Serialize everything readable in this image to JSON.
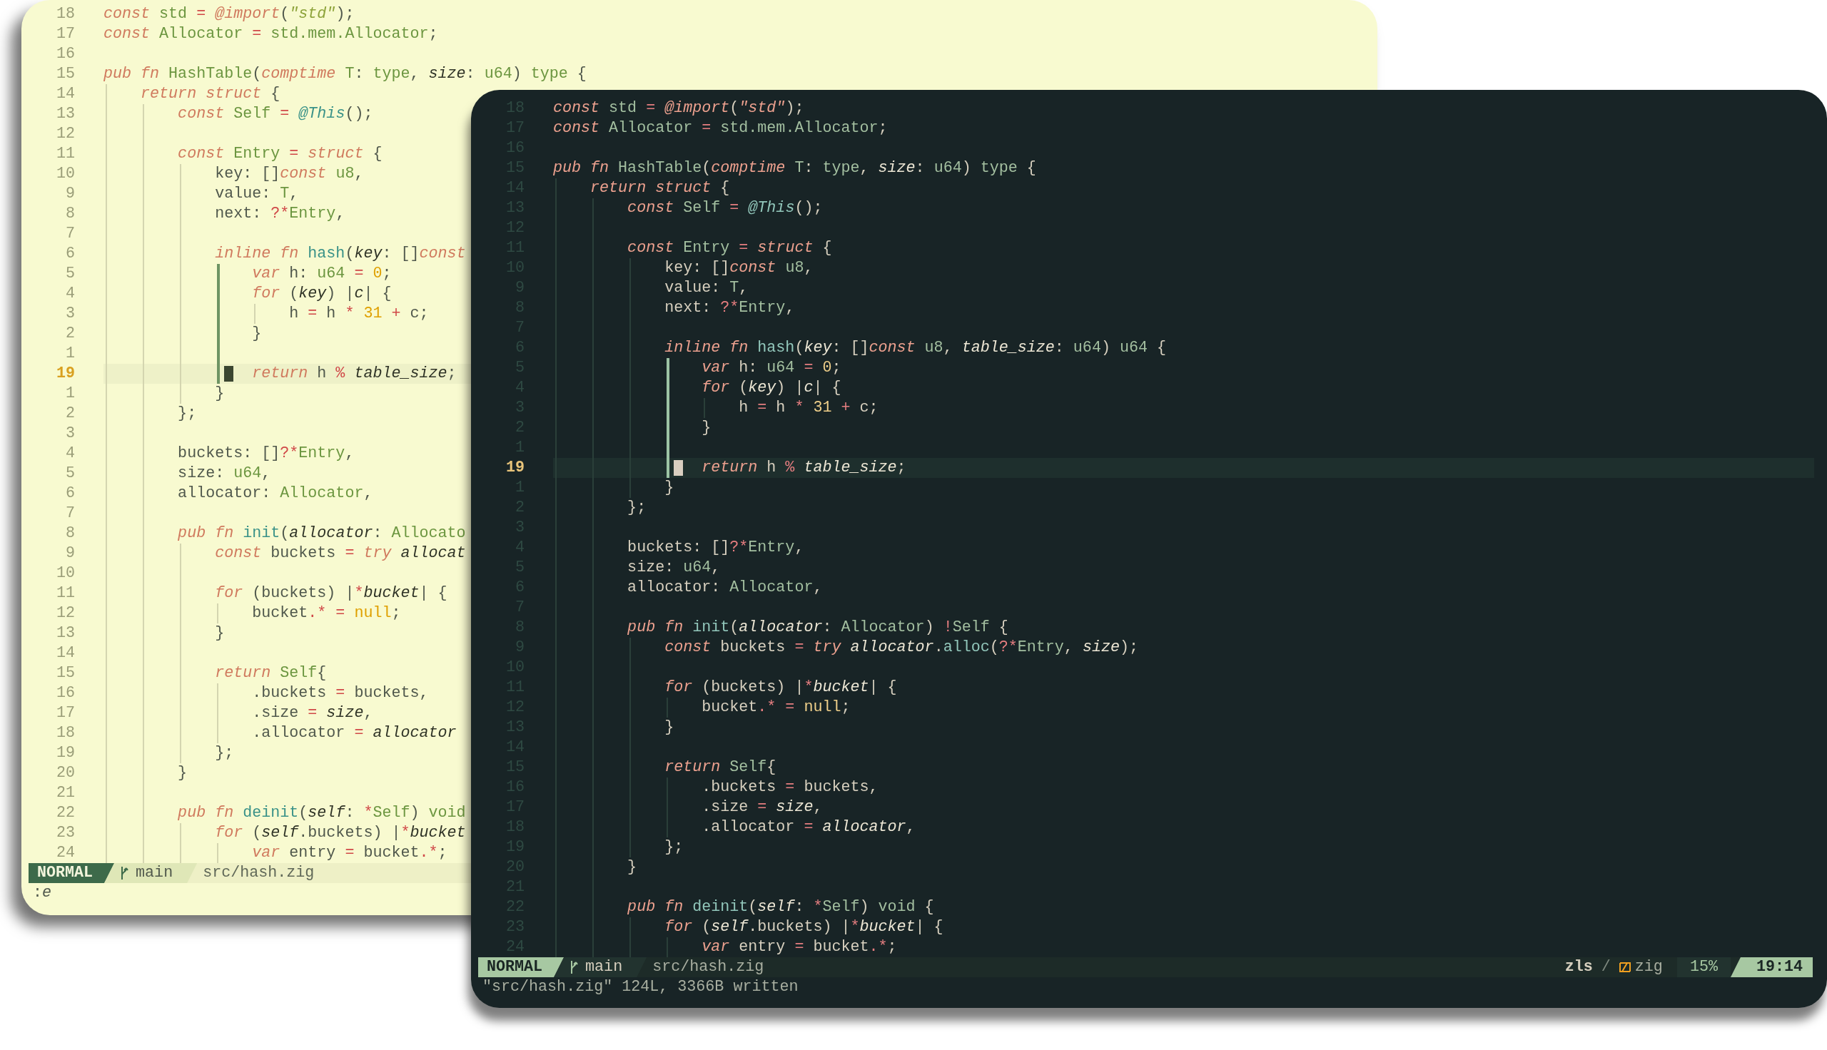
{
  "windows": [
    {
      "kind": "light",
      "lines": [
        {
          "number": "18",
          "current": false,
          "code": [
            {
              "kind": "kw",
              "text": "const "
            },
            {
              "kind": "type",
              "text": "std"
            },
            {
              "kind": "op",
              "text": " = "
            },
            {
              "kind": "kw",
              "text": "@import"
            },
            {
              "kind": "plain",
              "text": "("
            },
            {
              "kind": "str",
              "text": "\"std\""
            },
            {
              "kind": "plain",
              "text": ");"
            }
          ]
        },
        {
          "number": "17",
          "current": false,
          "code": [
            {
              "kind": "kw",
              "text": "const "
            },
            {
              "kind": "type",
              "text": "Allocator"
            },
            {
              "kind": "op",
              "text": " = "
            },
            {
              "kind": "type",
              "text": "std.mem.Allocator"
            },
            {
              "kind": "plain",
              "text": ";"
            }
          ]
        },
        {
          "number": "16",
          "current": false
        },
        {
          "number": "15",
          "current": false,
          "code": [
            {
              "kind": "kw",
              "text": "pub fn "
            },
            {
              "kind": "type",
              "text": "HashTable"
            },
            {
              "kind": "plain",
              "text": "("
            },
            {
              "kind": "kw",
              "text": "comptime "
            },
            {
              "kind": "type",
              "text": "T"
            },
            {
              "kind": "plain",
              "text": ": "
            },
            {
              "kind": "type",
              "text": "type"
            },
            {
              "kind": "plain",
              "text": ", "
            },
            {
              "kind": "param",
              "text": "size"
            },
            {
              "kind": "plain",
              "text": ": "
            },
            {
              "kind": "type",
              "text": "u64"
            },
            {
              "kind": "plain",
              "text": ") "
            },
            {
              "kind": "type",
              "text": "type"
            },
            {
              "kind": "plain",
              "text": " {"
            }
          ]
        },
        {
          "number": "14",
          "current": false,
          "code": [
            {
              "kind": "kw",
              "text": "    return struct "
            },
            {
              "kind": "plain",
              "text": "{"
            }
          ]
        },
        {
          "number": "13",
          "current": false,
          "code": [
            {
              "kind": "kw",
              "text": "        const "
            },
            {
              "kind": "type",
              "text": "Self"
            },
            {
              "kind": "op",
              "text": " = "
            },
            {
              "kind": "builtin",
              "text": "@This"
            },
            {
              "kind": "plain",
              "text": "();"
            }
          ]
        },
        {
          "number": "12",
          "current": false
        },
        {
          "number": "11",
          "current": false,
          "code": [
            {
              "kind": "kw",
              "text": "        const "
            },
            {
              "kind": "type",
              "text": "Entry"
            },
            {
              "kind": "op",
              "text": " = "
            },
            {
              "kind": "kw",
              "text": "struct "
            },
            {
              "kind": "plain",
              "text": "{"
            }
          ]
        },
        {
          "number": "10",
          "current": false,
          "code": [
            {
              "kind": "plain",
              "text": "            key: []"
            },
            {
              "kind": "kw",
              "text": "const "
            },
            {
              "kind": "type",
              "text": "u8"
            },
            {
              "kind": "plain",
              "text": ","
            }
          ]
        },
        {
          "number": "9",
          "current": false,
          "code": [
            {
              "kind": "plain",
              "text": "            value: "
            },
            {
              "kind": "type",
              "text": "T"
            },
            {
              "kind": "plain",
              "text": ","
            }
          ]
        },
        {
          "number": "8",
          "current": false,
          "code": [
            {
              "kind": "plain",
              "text": "            next: "
            },
            {
              "kind": "op",
              "text": "?*"
            },
            {
              "kind": "type",
              "text": "Entry"
            },
            {
              "kind": "plain",
              "text": ","
            }
          ]
        },
        {
          "number": "7",
          "current": false
        },
        {
          "number": "6",
          "current": false,
          "code": [
            {
              "kind": "kw",
              "text": "            inline fn "
            },
            {
              "kind": "fn",
              "text": "hash"
            },
            {
              "kind": "plain",
              "text": "("
            },
            {
              "kind": "param",
              "text": "key"
            },
            {
              "kind": "plain",
              "text": ": []"
            },
            {
              "kind": "kw",
              "text": "const"
            }
          ]
        },
        {
          "number": "5",
          "current": false,
          "code": [
            {
              "kind": "kw",
              "text": "                var "
            },
            {
              "kind": "plain",
              "text": "h: "
            },
            {
              "kind": "type",
              "text": "u64"
            },
            {
              "kind": "op",
              "text": " = "
            },
            {
              "kind": "num",
              "text": "0"
            },
            {
              "kind": "plain",
              "text": ";"
            }
          ]
        },
        {
          "number": "4",
          "current": false,
          "code": [
            {
              "kind": "kw",
              "text": "                for "
            },
            {
              "kind": "plain",
              "text": "("
            },
            {
              "kind": "param",
              "text": "key"
            },
            {
              "kind": "plain",
              "text": ") |"
            },
            {
              "kind": "param",
              "text": "c"
            },
            {
              "kind": "plain",
              "text": "| {"
            }
          ]
        },
        {
          "number": "3",
          "current": false,
          "code": [
            {
              "kind": "plain",
              "text": "                    h"
            },
            {
              "kind": "op",
              "text": " = "
            },
            {
              "kind": "plain",
              "text": "h"
            },
            {
              "kind": "op",
              "text": " * "
            },
            {
              "kind": "num",
              "text": "31"
            },
            {
              "kind": "op",
              "text": " + "
            },
            {
              "kind": "plain",
              "text": "c;"
            }
          ]
        },
        {
          "number": "2",
          "current": false,
          "code": [
            {
              "kind": "plain",
              "text": "                }"
            }
          ]
        },
        {
          "number": "1",
          "current": false
        },
        {
          "number": "19",
          "current": true,
          "code": [
            {
              "kind": "kw",
              "text": "                return "
            },
            {
              "kind": "plain",
              "text": "h"
            },
            {
              "kind": "op",
              "text": " % "
            },
            {
              "kind": "param",
              "text": "table_size"
            },
            {
              "kind": "plain",
              "text": ";"
            }
          ]
        },
        {
          "number": "1",
          "current": false,
          "code": [
            {
              "kind": "plain",
              "text": "            }"
            }
          ]
        },
        {
          "number": "2",
          "current": false,
          "code": [
            {
              "kind": "plain",
              "text": "        };"
            }
          ]
        },
        {
          "number": "3",
          "current": false
        },
        {
          "number": "4",
          "current": false,
          "code": [
            {
              "kind": "plain",
              "text": "        buckets: []"
            },
            {
              "kind": "op",
              "text": "?*"
            },
            {
              "kind": "type",
              "text": "Entry"
            },
            {
              "kind": "plain",
              "text": ","
            }
          ]
        },
        {
          "number": "5",
          "current": false,
          "code": [
            {
              "kind": "plain",
              "text": "        size: "
            },
            {
              "kind": "type",
              "text": "u64"
            },
            {
              "kind": "plain",
              "text": ","
            }
          ]
        },
        {
          "number": "6",
          "current": false,
          "code": [
            {
              "kind": "plain",
              "text": "        allocator: "
            },
            {
              "kind": "type",
              "text": "Allocator"
            },
            {
              "kind": "plain",
              "text": ","
            }
          ]
        },
        {
          "number": "7",
          "current": false
        },
        {
          "number": "8",
          "current": false,
          "code": [
            {
              "kind": "kw",
              "text": "        pub fn "
            },
            {
              "kind": "fn",
              "text": "init"
            },
            {
              "kind": "plain",
              "text": "("
            },
            {
              "kind": "param",
              "text": "allocator"
            },
            {
              "kind": "plain",
              "text": ": "
            },
            {
              "kind": "type",
              "text": "Allocato"
            }
          ]
        },
        {
          "number": "9",
          "current": false,
          "code": [
            {
              "kind": "kw",
              "text": "            const "
            },
            {
              "kind": "plain",
              "text": "buckets"
            },
            {
              "kind": "op",
              "text": " = "
            },
            {
              "kind": "kw",
              "text": "try "
            },
            {
              "kind": "param",
              "text": "allocat"
            }
          ]
        },
        {
          "number": "10",
          "current": false
        },
        {
          "number": "11",
          "current": false,
          "code": [
            {
              "kind": "kw",
              "text": "            for "
            },
            {
              "kind": "plain",
              "text": "(buckets) |"
            },
            {
              "kind": "op",
              "text": "*"
            },
            {
              "kind": "param",
              "text": "bucket"
            },
            {
              "kind": "plain",
              "text": "| {"
            }
          ]
        },
        {
          "number": "12",
          "current": false,
          "code": [
            {
              "kind": "plain",
              "text": "                bucket"
            },
            {
              "kind": "op",
              "text": ".* = "
            },
            {
              "kind": "num",
              "text": "null"
            },
            {
              "kind": "plain",
              "text": ";"
            }
          ]
        },
        {
          "number": "13",
          "current": false,
          "code": [
            {
              "kind": "plain",
              "text": "            }"
            }
          ]
        },
        {
          "number": "14",
          "current": false
        },
        {
          "number": "15",
          "current": false,
          "code": [
            {
              "kind": "kw",
              "text": "            return "
            },
            {
              "kind": "type",
              "text": "Self"
            },
            {
              "kind": "plain",
              "text": "{"
            }
          ]
        },
        {
          "number": "16",
          "current": false,
          "code": [
            {
              "kind": "plain",
              "text": "                .buckets"
            },
            {
              "kind": "op",
              "text": " = "
            },
            {
              "kind": "plain",
              "text": "buckets,"
            }
          ]
        },
        {
          "number": "17",
          "current": false,
          "code": [
            {
              "kind": "plain",
              "text": "                .size"
            },
            {
              "kind": "op",
              "text": " = "
            },
            {
              "kind": "param",
              "text": "size"
            },
            {
              "kind": "plain",
              "text": ","
            }
          ]
        },
        {
          "number": "18",
          "current": false,
          "code": [
            {
              "kind": "plain",
              "text": "                .allocator"
            },
            {
              "kind": "op",
              "text": " = "
            },
            {
              "kind": "param",
              "text": "allocator"
            }
          ]
        },
        {
          "number": "19",
          "current": false,
          "code": [
            {
              "kind": "plain",
              "text": "            };"
            }
          ]
        },
        {
          "number": "20",
          "current": false,
          "code": [
            {
              "kind": "plain",
              "text": "        }"
            }
          ]
        },
        {
          "number": "21",
          "current": false
        },
        {
          "number": "22",
          "current": false,
          "code": [
            {
              "kind": "kw",
              "text": "        pub fn "
            },
            {
              "kind": "fn",
              "text": "deinit"
            },
            {
              "kind": "plain",
              "text": "("
            },
            {
              "kind": "param",
              "text": "self"
            },
            {
              "kind": "plain",
              "text": ": "
            },
            {
              "kind": "op",
              "text": "*"
            },
            {
              "kind": "type",
              "text": "Self"
            },
            {
              "kind": "plain",
              "text": ") "
            },
            {
              "kind": "type",
              "text": "void"
            }
          ]
        },
        {
          "number": "23",
          "current": false,
          "code": [
            {
              "kind": "kw",
              "text": "            for "
            },
            {
              "kind": "plain",
              "text": "("
            },
            {
              "kind": "param",
              "text": "self"
            },
            {
              "kind": "plain",
              "text": ".buckets) |"
            },
            {
              "kind": "op",
              "text": "*"
            },
            {
              "kind": "param",
              "text": "bucket"
            }
          ]
        },
        {
          "number": "24",
          "current": false,
          "code": [
            {
              "kind": "kw",
              "text": "                var "
            },
            {
              "kind": "plain",
              "text": "entry"
            },
            {
              "kind": "op",
              "text": " = "
            },
            {
              "kind": "plain",
              "text": "bucket"
            },
            {
              "kind": "op",
              "text": ".*"
            },
            {
              "kind": "plain",
              "text": ";"
            }
          ]
        }
      ],
      "status": {
        "mode": "NORMAL",
        "branch": "main",
        "file": "src/hash.zig"
      },
      "command_line": ":*e*"
    },
    {
      "kind": "dark",
      "lines": [
        {
          "number": "18",
          "current": false,
          "code": [
            {
              "kind": "kw",
              "text": "const "
            },
            {
              "kind": "type",
              "text": "std"
            },
            {
              "kind": "op",
              "text": " = "
            },
            {
              "kind": "kw",
              "text": "@import"
            },
            {
              "kind": "plain",
              "text": "("
            },
            {
              "kind": "str",
              "text": "\"std\""
            },
            {
              "kind": "plain",
              "text": ");"
            }
          ]
        },
        {
          "number": "17",
          "current": false,
          "code": [
            {
              "kind": "kw",
              "text": "const "
            },
            {
              "kind": "type",
              "text": "Allocator"
            },
            {
              "kind": "op",
              "text": " = "
            },
            {
              "kind": "type",
              "text": "std.mem.Allocator"
            },
            {
              "kind": "plain",
              "text": ";"
            }
          ]
        },
        {
          "number": "16",
          "current": false
        },
        {
          "number": "15",
          "current": false,
          "code": [
            {
              "kind": "kw",
              "text": "pub fn "
            },
            {
              "kind": "type",
              "text": "HashTable"
            },
            {
              "kind": "plain",
              "text": "("
            },
            {
              "kind": "kw",
              "text": "comptime "
            },
            {
              "kind": "type",
              "text": "T"
            },
            {
              "kind": "plain",
              "text": ": "
            },
            {
              "kind": "type",
              "text": "type"
            },
            {
              "kind": "plain",
              "text": ", "
            },
            {
              "kind": "param",
              "text": "size"
            },
            {
              "kind": "plain",
              "text": ": "
            },
            {
              "kind": "type",
              "text": "u64"
            },
            {
              "kind": "plain",
              "text": ") "
            },
            {
              "kind": "type",
              "text": "type"
            },
            {
              "kind": "plain",
              "text": " {"
            }
          ]
        },
        {
          "number": "14",
          "current": false,
          "code": [
            {
              "kind": "kw",
              "text": "    return struct "
            },
            {
              "kind": "plain",
              "text": "{"
            }
          ]
        },
        {
          "number": "13",
          "current": false,
          "code": [
            {
              "kind": "kw",
              "text": "        const "
            },
            {
              "kind": "type",
              "text": "Self"
            },
            {
              "kind": "op",
              "text": " = "
            },
            {
              "kind": "builtin",
              "text": "@This"
            },
            {
              "kind": "plain",
              "text": "();"
            }
          ]
        },
        {
          "number": "12",
          "current": false
        },
        {
          "number": "11",
          "current": false,
          "code": [
            {
              "kind": "kw",
              "text": "        const "
            },
            {
              "kind": "type",
              "text": "Entry"
            },
            {
              "kind": "op",
              "text": " = "
            },
            {
              "kind": "kw",
              "text": "struct "
            },
            {
              "kind": "plain",
              "text": "{"
            }
          ]
        },
        {
          "number": "10",
          "current": false,
          "code": [
            {
              "kind": "plain",
              "text": "            key: []"
            },
            {
              "kind": "kw",
              "text": "const "
            },
            {
              "kind": "type",
              "text": "u8"
            },
            {
              "kind": "plain",
              "text": ","
            }
          ]
        },
        {
          "number": "9",
          "current": false,
          "code": [
            {
              "kind": "plain",
              "text": "            value: "
            },
            {
              "kind": "type",
              "text": "T"
            },
            {
              "kind": "plain",
              "text": ","
            }
          ]
        },
        {
          "number": "8",
          "current": false,
          "code": [
            {
              "kind": "plain",
              "text": "            next: "
            },
            {
              "kind": "op",
              "text": "?*"
            },
            {
              "kind": "type",
              "text": "Entry"
            },
            {
              "kind": "plain",
              "text": ","
            }
          ]
        },
        {
          "number": "7",
          "current": false
        },
        {
          "number": "6",
          "current": false,
          "code": [
            {
              "kind": "kw",
              "text": "            inline fn "
            },
            {
              "kind": "fn",
              "text": "hash"
            },
            {
              "kind": "plain",
              "text": "("
            },
            {
              "kind": "param",
              "text": "key"
            },
            {
              "kind": "plain",
              "text": ": []"
            },
            {
              "kind": "kw",
              "text": "const "
            },
            {
              "kind": "type",
              "text": "u8"
            },
            {
              "kind": "plain",
              "text": ", "
            },
            {
              "kind": "param",
              "text": "table_size"
            },
            {
              "kind": "plain",
              "text": ": "
            },
            {
              "kind": "type",
              "text": "u64"
            },
            {
              "kind": "plain",
              "text": ") "
            },
            {
              "kind": "type",
              "text": "u64"
            },
            {
              "kind": "plain",
              "text": " {"
            }
          ]
        },
        {
          "number": "5",
          "current": false,
          "code": [
            {
              "kind": "kw",
              "text": "                var "
            },
            {
              "kind": "plain",
              "text": "h: "
            },
            {
              "kind": "type",
              "text": "u64"
            },
            {
              "kind": "op",
              "text": " = "
            },
            {
              "kind": "num",
              "text": "0"
            },
            {
              "kind": "plain",
              "text": ";"
            }
          ]
        },
        {
          "number": "4",
          "current": false,
          "code": [
            {
              "kind": "kw",
              "text": "                for "
            },
            {
              "kind": "plain",
              "text": "("
            },
            {
              "kind": "param",
              "text": "key"
            },
            {
              "kind": "plain",
              "text": ") |"
            },
            {
              "kind": "param",
              "text": "c"
            },
            {
              "kind": "plain",
              "text": "| {"
            }
          ]
        },
        {
          "number": "3",
          "current": false,
          "code": [
            {
              "kind": "plain",
              "text": "                    h"
            },
            {
              "kind": "op",
              "text": " = "
            },
            {
              "kind": "plain",
              "text": "h"
            },
            {
              "kind": "op",
              "text": " * "
            },
            {
              "kind": "num",
              "text": "31"
            },
            {
              "kind": "op",
              "text": " + "
            },
            {
              "kind": "plain",
              "text": "c;"
            }
          ]
        },
        {
          "number": "2",
          "current": false,
          "code": [
            {
              "kind": "plain",
              "text": "                }"
            }
          ]
        },
        {
          "number": "1",
          "current": false
        },
        {
          "number": "19",
          "current": true,
          "code": [
            {
              "kind": "kw",
              "text": "                return "
            },
            {
              "kind": "plain",
              "text": "h"
            },
            {
              "kind": "op",
              "text": " % "
            },
            {
              "kind": "param",
              "text": "table_size"
            },
            {
              "kind": "plain",
              "text": ";"
            }
          ]
        },
        {
          "number": "1",
          "current": false,
          "code": [
            {
              "kind": "plain",
              "text": "            }"
            }
          ]
        },
        {
          "number": "2",
          "current": false,
          "code": [
            {
              "kind": "plain",
              "text": "        };"
            }
          ]
        },
        {
          "number": "3",
          "current": false
        },
        {
          "number": "4",
          "current": false,
          "code": [
            {
              "kind": "plain",
              "text": "        buckets: []"
            },
            {
              "kind": "op",
              "text": "?*"
            },
            {
              "kind": "type",
              "text": "Entry"
            },
            {
              "kind": "plain",
              "text": ","
            }
          ]
        },
        {
          "number": "5",
          "current": false,
          "code": [
            {
              "kind": "plain",
              "text": "        size: "
            },
            {
              "kind": "type",
              "text": "u64"
            },
            {
              "kind": "plain",
              "text": ","
            }
          ]
        },
        {
          "number": "6",
          "current": false,
          "code": [
            {
              "kind": "plain",
              "text": "        allocator: "
            },
            {
              "kind": "type",
              "text": "Allocator"
            },
            {
              "kind": "plain",
              "text": ","
            }
          ]
        },
        {
          "number": "7",
          "current": false
        },
        {
          "number": "8",
          "current": false,
          "code": [
            {
              "kind": "kw",
              "text": "        pub fn "
            },
            {
              "kind": "fn",
              "text": "init"
            },
            {
              "kind": "plain",
              "text": "("
            },
            {
              "kind": "param",
              "text": "allocator"
            },
            {
              "kind": "plain",
              "text": ": "
            },
            {
              "kind": "type",
              "text": "Allocator"
            },
            {
              "kind": "plain",
              "text": ") "
            },
            {
              "kind": "op",
              "text": "!"
            },
            {
              "kind": "type",
              "text": "Self"
            },
            {
              "kind": "plain",
              "text": " {"
            }
          ]
        },
        {
          "number": "9",
          "current": false,
          "code": [
            {
              "kind": "kw",
              "text": "            const "
            },
            {
              "kind": "plain",
              "text": "buckets"
            },
            {
              "kind": "op",
              "text": " = "
            },
            {
              "kind": "kw",
              "text": "try "
            },
            {
              "kind": "param",
              "text": "allocator"
            },
            {
              "kind": "plain",
              "text": "."
            },
            {
              "kind": "fn",
              "text": "alloc"
            },
            {
              "kind": "plain",
              "text": "("
            },
            {
              "kind": "op",
              "text": "?*"
            },
            {
              "kind": "type",
              "text": "Entry"
            },
            {
              "kind": "plain",
              "text": ", "
            },
            {
              "kind": "param",
              "text": "size"
            },
            {
              "kind": "plain",
              "text": ");"
            }
          ]
        },
        {
          "number": "10",
          "current": false
        },
        {
          "number": "11",
          "current": false,
          "code": [
            {
              "kind": "kw",
              "text": "            for "
            },
            {
              "kind": "plain",
              "text": "(buckets) |"
            },
            {
              "kind": "op",
              "text": "*"
            },
            {
              "kind": "param",
              "text": "bucket"
            },
            {
              "kind": "plain",
              "text": "| {"
            }
          ]
        },
        {
          "number": "12",
          "current": false,
          "code": [
            {
              "kind": "plain",
              "text": "                bucket"
            },
            {
              "kind": "op",
              "text": ".* = "
            },
            {
              "kind": "num",
              "text": "null"
            },
            {
              "kind": "plain",
              "text": ";"
            }
          ]
        },
        {
          "number": "13",
          "current": false,
          "code": [
            {
              "kind": "plain",
              "text": "            }"
            }
          ]
        },
        {
          "number": "14",
          "current": false
        },
        {
          "number": "15",
          "current": false,
          "code": [
            {
              "kind": "kw",
              "text": "            return "
            },
            {
              "kind": "type",
              "text": "Self"
            },
            {
              "kind": "plain",
              "text": "{"
            }
          ]
        },
        {
          "number": "16",
          "current": false,
          "code": [
            {
              "kind": "plain",
              "text": "                .buckets"
            },
            {
              "kind": "op",
              "text": " = "
            },
            {
              "kind": "plain",
              "text": "buckets,"
            }
          ]
        },
        {
          "number": "17",
          "current": false,
          "code": [
            {
              "kind": "plain",
              "text": "                .size"
            },
            {
              "kind": "op",
              "text": " = "
            },
            {
              "kind": "param",
              "text": "size"
            },
            {
              "kind": "plain",
              "text": ","
            }
          ]
        },
        {
          "number": "18",
          "current": false,
          "code": [
            {
              "kind": "plain",
              "text": "                .allocator"
            },
            {
              "kind": "op",
              "text": " = "
            },
            {
              "kind": "param",
              "text": "allocator"
            },
            {
              "kind": "plain",
              "text": ","
            }
          ]
        },
        {
          "number": "19",
          "current": false,
          "code": [
            {
              "kind": "plain",
              "text": "            };"
            }
          ]
        },
        {
          "number": "20",
          "current": false,
          "code": [
            {
              "kind": "plain",
              "text": "        }"
            }
          ]
        },
        {
          "number": "21",
          "current": false
        },
        {
          "number": "22",
          "current": false,
          "code": [
            {
              "kind": "kw",
              "text": "        pub fn "
            },
            {
              "kind": "fn",
              "text": "deinit"
            },
            {
              "kind": "plain",
              "text": "("
            },
            {
              "kind": "param",
              "text": "self"
            },
            {
              "kind": "plain",
              "text": ": "
            },
            {
              "kind": "op",
              "text": "*"
            },
            {
              "kind": "type",
              "text": "Self"
            },
            {
              "kind": "plain",
              "text": ") "
            },
            {
              "kind": "type",
              "text": "void"
            },
            {
              "kind": "plain",
              "text": " {"
            }
          ]
        },
        {
          "number": "23",
          "current": false,
          "code": [
            {
              "kind": "kw",
              "text": "            for "
            },
            {
              "kind": "plain",
              "text": "("
            },
            {
              "kind": "param",
              "text": "self"
            },
            {
              "kind": "plain",
              "text": ".buckets) |"
            },
            {
              "kind": "op",
              "text": "*"
            },
            {
              "kind": "param",
              "text": "bucket"
            },
            {
              "kind": "plain",
              "text": "| {"
            }
          ]
        },
        {
          "number": "24",
          "current": false,
          "code": [
            {
              "kind": "kw",
              "text": "                var "
            },
            {
              "kind": "plain",
              "text": "entry"
            },
            {
              "kind": "op",
              "text": " = "
            },
            {
              "kind": "plain",
              "text": "bucket"
            },
            {
              "kind": "op",
              "text": ".*"
            },
            {
              "kind": "plain",
              "text": ";"
            }
          ]
        }
      ],
      "status": {
        "mode": "NORMAL",
        "branch": "main",
        "file": "src/hash.zig",
        "lsp": "zls",
        "separator": "/",
        "filetype": "zig",
        "scroll": "15%",
        "position": "19:14"
      },
      "command_line": "\"src/hash.zig\" 124L, 3366B written"
    }
  ]
}
